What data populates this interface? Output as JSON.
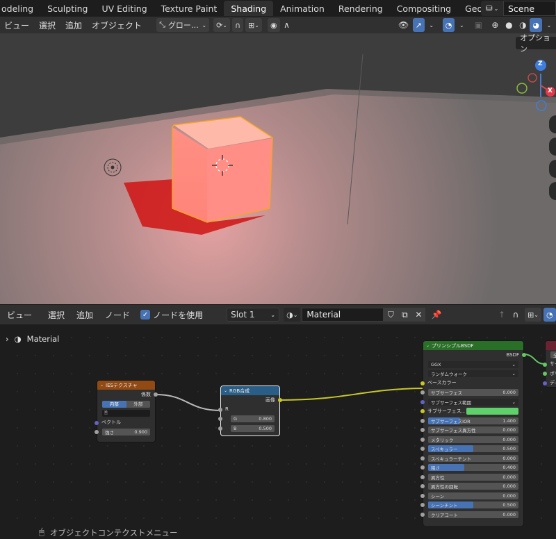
{
  "workspace_tabs": [
    "odeling",
    "Sculpting",
    "UV Editing",
    "Texture Paint",
    "Shading",
    "Animation",
    "Rendering",
    "Compositing",
    "Geometry Nodes",
    "S"
  ],
  "scene": {
    "name": "Scene"
  },
  "viewport": {
    "menus": [
      "ビュー",
      "選択",
      "追加",
      "オブジェクト"
    ],
    "orientation": "グロー…",
    "options_label": "オプション",
    "axes": {
      "z": "Z",
      "x": "X"
    }
  },
  "node_editor": {
    "menus": [
      "ビュー",
      "選択",
      "追加",
      "ノード"
    ],
    "use_nodes_label": "ノードを使用",
    "slot": "Slot 1",
    "material_name": "Material",
    "breadcrumb": "Material"
  },
  "nodes": {
    "ies": {
      "title": "IESテクスチャ",
      "out_label": "係数",
      "mode_internal": "内部",
      "mode_external": "外部",
      "vector_label": "ベクトル",
      "strength_label": "強さ",
      "strength_value": "0.900"
    },
    "combine": {
      "title": "RGB合成",
      "out_label": "画像",
      "r_label": "R",
      "g_label": "G",
      "g_value": "0.800",
      "b_label": "B",
      "b_value": "0.500"
    },
    "bsdf": {
      "title": "プリンシプルBSDF",
      "out_label": "BSDF",
      "distribution": "GGX",
      "subsurface_method": "ランダムウォーク",
      "base_color_label": "ベースカラー",
      "subsurface_color": "#5fd16a",
      "rows": [
        {
          "label": "サブサーフェス",
          "value": "0.000",
          "fill": 0
        },
        {
          "label": "サブサーフェス範囲",
          "value": "",
          "fill": 0
        },
        {
          "label": "サブサーフェス...",
          "value": "",
          "fill": 0
        },
        {
          "label": "サブサーフェスIOR",
          "value": "1.400",
          "fill": 0.35
        },
        {
          "label": "サブサーフェス異方性",
          "value": "0.000",
          "fill": 0
        },
        {
          "label": "メタリック",
          "value": "0.000",
          "fill": 0
        },
        {
          "label": "スペキュラー",
          "value": "0.500",
          "fill": 0.5
        },
        {
          "label": "スペキュラーチント",
          "value": "0.000",
          "fill": 0
        },
        {
          "label": "粗さ",
          "value": "0.400",
          "fill": 0.4
        },
        {
          "label": "異方性",
          "value": "0.000",
          "fill": 0
        },
        {
          "label": "異方性の回転",
          "value": "0.000",
          "fill": 0
        },
        {
          "label": "シーン",
          "value": "0.000",
          "fill": 0
        },
        {
          "label": "シーンチント",
          "value": "0.500",
          "fill": 0.5
        },
        {
          "label": "クリアコート",
          "value": "0.000",
          "fill": 0
        }
      ]
    },
    "output": {
      "title": "",
      "items": [
        "全",
        "サー",
        "ボリ",
        "ディ"
      ]
    }
  },
  "status": {
    "hint": "オブジェクトコンテクストメニュー"
  },
  "colors": {
    "accent": "#4772b3",
    "texture_header": "#924a14",
    "converter_header": "#2b5e86",
    "shader_header": "#2a6f27",
    "output_header": "#6b2332",
    "link_yellow": "#c7c729"
  }
}
